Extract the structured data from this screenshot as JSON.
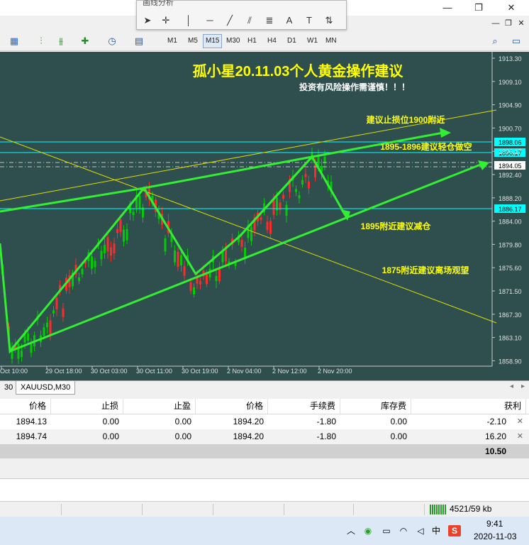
{
  "window": {
    "title_partial": "",
    "controls": {
      "minimize": "—",
      "restore": "❐",
      "close": "✕"
    }
  },
  "floating_toolbar": {
    "title": "画线分析",
    "tools": [
      "cursor-icon",
      "crosshair-icon",
      "vertical-line-icon",
      "horizontal-line-icon",
      "trendline-icon",
      "channel-icon",
      "fibonacci-icon",
      "text-icon",
      "label-icon",
      "arrows-icon"
    ]
  },
  "sub_controls": {
    "minimize": "—",
    "restore": "❐",
    "close": "✕"
  },
  "timeframes": [
    "M1",
    "M5",
    "M15",
    "M30",
    "H1",
    "H4",
    "D1",
    "W1",
    "MN"
  ],
  "active_timeframe": "M15",
  "chart": {
    "title": "孤小星20.11.03个人黄金操作建议",
    "subtitle": "投资有风险操作需谨慎！！！",
    "annotations": [
      {
        "text": "建议止损位1900附近"
      },
      {
        "text": "1895-1896建议轻仓做空"
      },
      {
        "text": "1895附近建议减仓"
      },
      {
        "text": "1875附近建议离场观望"
      }
    ],
    "price_ticks": [
      "1913.30",
      "1909.10",
      "1904.90",
      "1900.70",
      "1896.17",
      "1892.40",
      "1888.20",
      "1884.00",
      "1879.80",
      "1875.60",
      "1871.50",
      "1867.30",
      "1863.10",
      "1858.90"
    ],
    "price_labels": [
      {
        "text": "1898.06",
        "highlight": false
      },
      {
        "text": "1896.17",
        "highlight": false
      },
      {
        "text": "1894.05",
        "highlight": true
      },
      {
        "text": "1886.17",
        "highlight": false
      }
    ],
    "time_ticks": [
      "Oct 10:00",
      "29 Oct 18:00",
      "30 Oct 03:00",
      "30 Oct 11:00",
      "30 Oct 19:00",
      "2 Nov 04:00",
      "2 Nov 12:00",
      "2 Nov 20:00"
    ],
    "colors": {
      "bg": "#2f4f4f",
      "bull": "#ff2a2a",
      "bear": "#00cc00",
      "trend": "#33ee33",
      "text": "#ffff00",
      "hline": "#00ffff"
    }
  },
  "tabs": [
    {
      "label": "30",
      "active": false
    },
    {
      "label": "XAUUSD,M30",
      "active": true
    }
  ],
  "table": {
    "headers": [
      "价格",
      "止损",
      "止盈",
      "价格",
      "手续费",
      "库存费",
      "获利"
    ],
    "rows": [
      [
        "1894.13",
        "0.00",
        "0.00",
        "1894.20",
        "-1.80",
        "0.00",
        "-2.10"
      ],
      [
        "1894.74",
        "0.00",
        "0.00",
        "1894.20",
        "-1.80",
        "0.00",
        "16.20"
      ]
    ],
    "total": "10.50"
  },
  "status": {
    "traffic": "4521/59 kb"
  },
  "taskbar": {
    "time": "9:41",
    "date": "2020-11-03",
    "ime": "中"
  }
}
